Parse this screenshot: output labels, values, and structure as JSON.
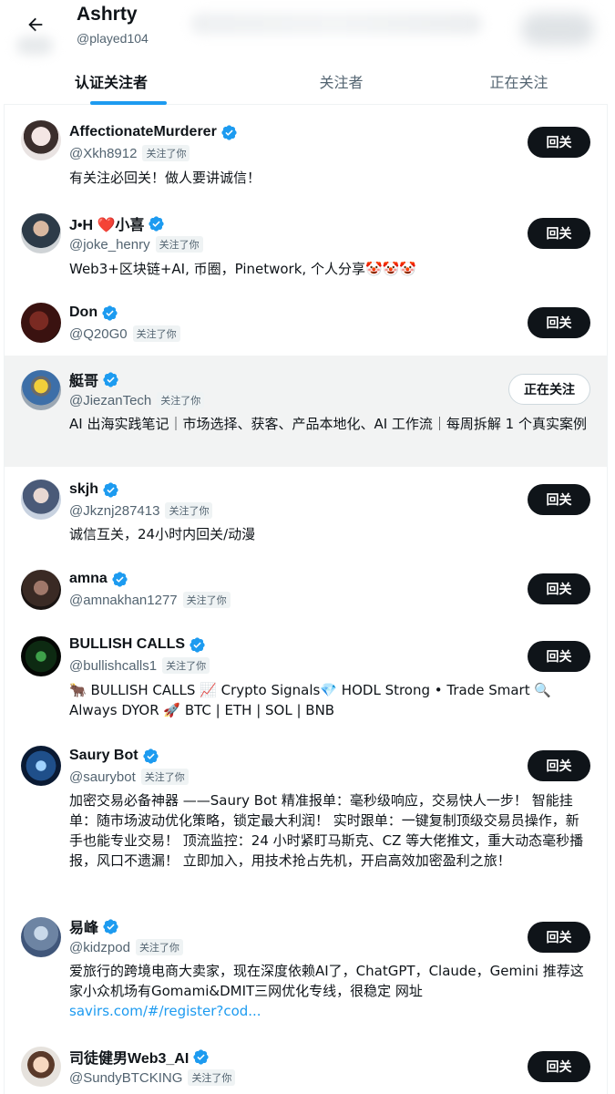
{
  "header": {
    "title": "Ashrty",
    "handle": "@played104"
  },
  "tabs": [
    {
      "label": "认证关注者",
      "active": true
    },
    {
      "label": "关注者",
      "active": false
    },
    {
      "label": "正在关注",
      "active": false
    }
  ],
  "accent_color": "#1d9bf0",
  "users": [
    {
      "name": "AffectionateMurderer",
      "handle": "@Xkh8912",
      "follows_you": "关注了你",
      "bio": "有关注必回关！做人要讲诚信！",
      "button": "回关"
    },
    {
      "name": "J•H ❤️小喜",
      "handle": "@joke_henry",
      "follows_you": "关注了你",
      "bio": "Web3+区块链+AI, 币圈，Pinetwork, 个人分享🤡🤡🤡",
      "button": "回关"
    },
    {
      "name": "Don",
      "handle": "@Q20G0",
      "follows_you": "关注了你",
      "bio": "",
      "button": "回关"
    },
    {
      "name": "艇哥",
      "handle": "@JiezanTech",
      "follows_you": "关注了你",
      "bio": "AI 出海实践笔记｜市场选择、获客、产品本地化、AI 工作流｜每周拆解 1 个真实案例",
      "button": "正在关注"
    },
    {
      "name": "skjh",
      "handle": "@Jkznj287413",
      "follows_you": "关注了你",
      "bio": "诚信互关，24小时内回关/动漫",
      "button": "回关"
    },
    {
      "name": "amna",
      "handle": "@amnakhan1277",
      "follows_you": "关注了你",
      "bio": "",
      "button": "回关"
    },
    {
      "name": "BULLISH CALLS",
      "handle": "@bullishcalls1",
      "follows_you": "关注了你",
      "bio": "🐂 BULLISH CALLS 📈 Crypto Signals💎 HODL Strong • Trade Smart 🔍 Always DYOR 🚀 BTC | ETH | SOL | BNB",
      "button": "回关"
    },
    {
      "name": "Saury Bot",
      "handle": "@saurybot",
      "follows_you": "关注了你",
      "bio": "加密交易必备神器 ——Saury Bot 精准报单：毫秒级响应，交易快人一步！ 智能挂单：随市场波动优化策略，锁定最大利润！ 实时跟单：一键复制顶级交易员操作，新手也能专业交易！ 顶流监控：24 小时紧盯马斯克、CZ 等大佬推文，重大动态毫秒播报，风口不遗漏！ 立即加入，用技术抢占先机，开启高效加密盈利之旅！",
      "button": "回关"
    },
    {
      "name": "易峰",
      "handle": "@kidzpod",
      "follows_you": "关注了你",
      "bio": "爱旅行的跨境电商大卖家，现在深度依赖AI了，ChatGPT，Claude，Gemini 推荐这家小众机场有Gomami&DMIT三网优化专线，很稳定 网址",
      "bio_link": "savirs.com/#/register?cod...",
      "button": "回关"
    },
    {
      "name": "司徒健男Web3_AI",
      "handle": "@SundyBTCKING",
      "follows_you": "关注了你",
      "bio": "",
      "button": "回关"
    }
  ]
}
